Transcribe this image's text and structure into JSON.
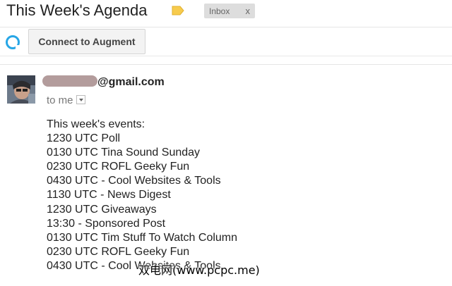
{
  "email": {
    "subject": "This Week's Agenda",
    "label_icon": "label-tag-icon",
    "label_color": "#f7cb4d",
    "inbox_chip": {
      "label": "Inbox",
      "remove": "x"
    },
    "toolbar": {
      "augment_button": "Connect to Augment",
      "augment_icon": "augment-logo-icon",
      "accent": "#27a6e6"
    },
    "sender": {
      "address_visible": "@gmail.com",
      "recipient": "to me"
    },
    "body_lines": [
      "This week's events:",
      "1230 UTC Poll",
      "0130 UTC Tina Sound Sunday",
      "0230 UTC ROFL Geeky Fun",
      "0430 UTC - Cool Websites & Tools",
      "1130 UTC - News Digest",
      "1230 UTC Giveaways",
      "13:30 - Sponsored Post",
      "0130 UTC Tim Stuff To Watch Column",
      "0230 UTC ROFL Geeky Fun",
      "0430 UTC - Cool Websites & Tools"
    ]
  },
  "watermark": "双电网(www.pcpc.me)"
}
